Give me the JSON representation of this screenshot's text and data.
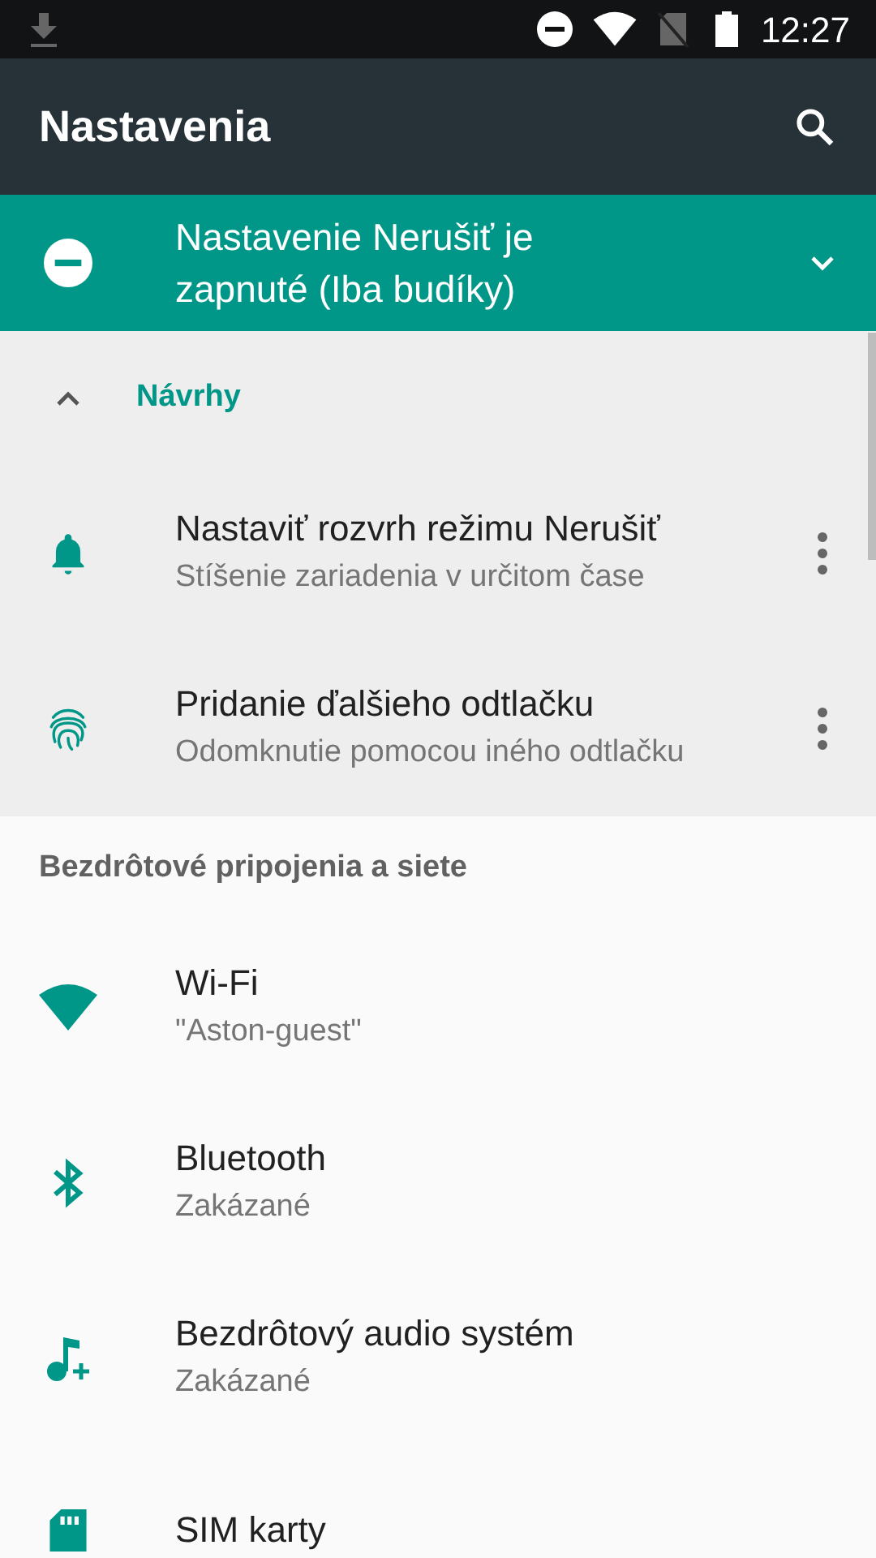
{
  "status_bar": {
    "time": "12:27"
  },
  "toolbar": {
    "title": "Nastavenia"
  },
  "dnd_banner": {
    "text": "Nastavenie Nerušiť je zapnuté (Iba budíky)",
    "expanded": false
  },
  "suggestions": {
    "title": "Návrhy",
    "expanded": true,
    "items": [
      {
        "title": "Nastaviť rozvrh režimu Nerušiť",
        "subtitle": "Stíšenie zariadenia v určitom čase"
      },
      {
        "title": "Pridanie ďalšieho odtlačku",
        "subtitle": "Odomknutie pomocou iného odtlačku"
      }
    ]
  },
  "category": {
    "title": "Bezdrôtové pripojenia a siete",
    "items": [
      {
        "title": "Wi-Fi",
        "subtitle": "\"Aston-guest\""
      },
      {
        "title": "Bluetooth",
        "subtitle": "Zakázané"
      },
      {
        "title": "Bezdrôtový audio systém",
        "subtitle": "Zakázané"
      },
      {
        "title": "SIM karty"
      }
    ]
  }
}
